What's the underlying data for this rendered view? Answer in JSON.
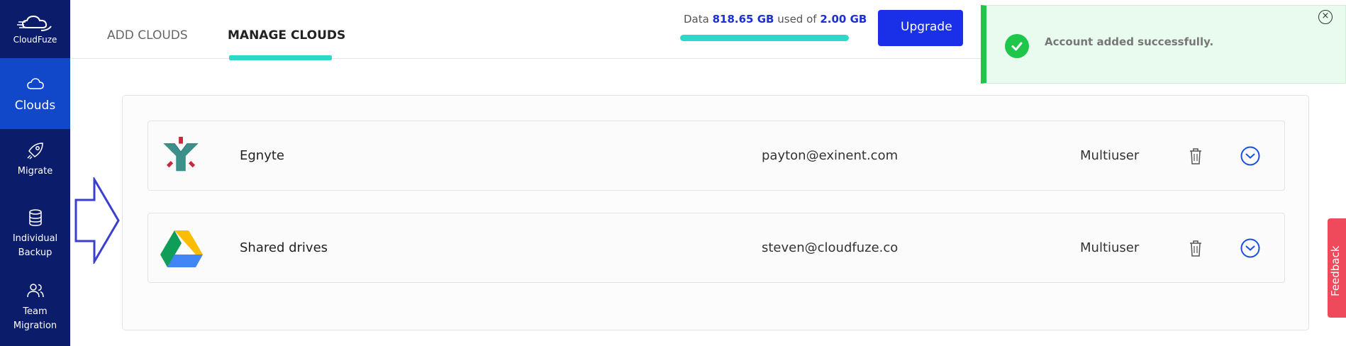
{
  "sidebar": {
    "logo_text": "CloudFuze",
    "items": [
      {
        "label": "Clouds",
        "icon": "cloud-icon"
      },
      {
        "label": "Migrate",
        "icon": "rocket-icon"
      },
      {
        "label_line1": "Individual",
        "label_line2": "Backup",
        "icon": "database-icon"
      },
      {
        "label_line1": "Team",
        "label_line2": "Migration",
        "icon": "users-icon"
      }
    ]
  },
  "header": {
    "tabs": [
      {
        "label": "ADD CLOUDS",
        "active": false
      },
      {
        "label": "MANAGE CLOUDS",
        "active": true
      }
    ],
    "usage": {
      "prefix": "Data",
      "used": "818.65 GB",
      "middle": "used of",
      "total": "2.00 GB",
      "fill_percent": 100
    },
    "upgrade_label": "Upgrade"
  },
  "toast": {
    "message": "Account added successfully.",
    "close_glyph": "×"
  },
  "clouds": [
    {
      "name": "Egnyte",
      "email": "payton@exinent.com",
      "type": "Multiuser",
      "logo": "egnyte-logo"
    },
    {
      "name": "Shared drives",
      "email": "steven@cloudfuze.co",
      "type": "Multiuser",
      "logo": "google-drive-logo"
    }
  ],
  "feedback_label": "Feedback",
  "colors": {
    "sidebar": "#0b1c6b",
    "sidebar_active": "#1147c9",
    "accent": "#2bd9c8",
    "primary": "#1a2fe8",
    "success": "#1ec64a",
    "feedback": "#ef4a5c"
  }
}
